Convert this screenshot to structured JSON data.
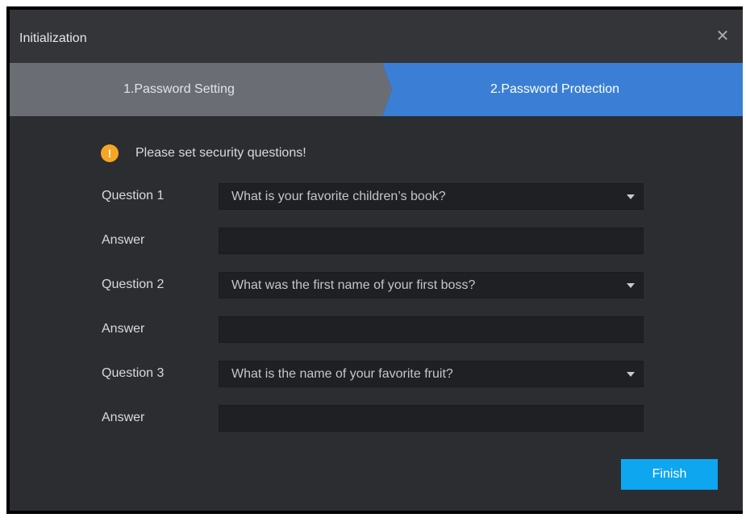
{
  "dialog": {
    "title": "Initialization",
    "close_icon": "close-icon"
  },
  "steps": [
    {
      "label": "1.Password Setting",
      "active": false
    },
    {
      "label": "2.Password Protection",
      "active": true
    }
  ],
  "notice": {
    "icon": "warning-icon",
    "text": "Please set security questions!"
  },
  "form": {
    "questions": [
      {
        "label": "Question 1",
        "selected": "What is your favorite children’s book?"
      },
      {
        "label": "Question 2",
        "selected": "What was the first name of your first boss?"
      },
      {
        "label": "Question 3",
        "selected": "What is the name of your favorite fruit?"
      }
    ],
    "answers": [
      {
        "label": "Answer",
        "value": ""
      },
      {
        "label": "Answer",
        "value": ""
      },
      {
        "label": "Answer",
        "value": ""
      }
    ]
  },
  "footer": {
    "finish_label": "Finish"
  },
  "colors": {
    "active_step": "#3a7fd5",
    "inactive_step": "#6a6e74",
    "accent_button": "#0ea6ee",
    "warning": "#f5a623"
  }
}
